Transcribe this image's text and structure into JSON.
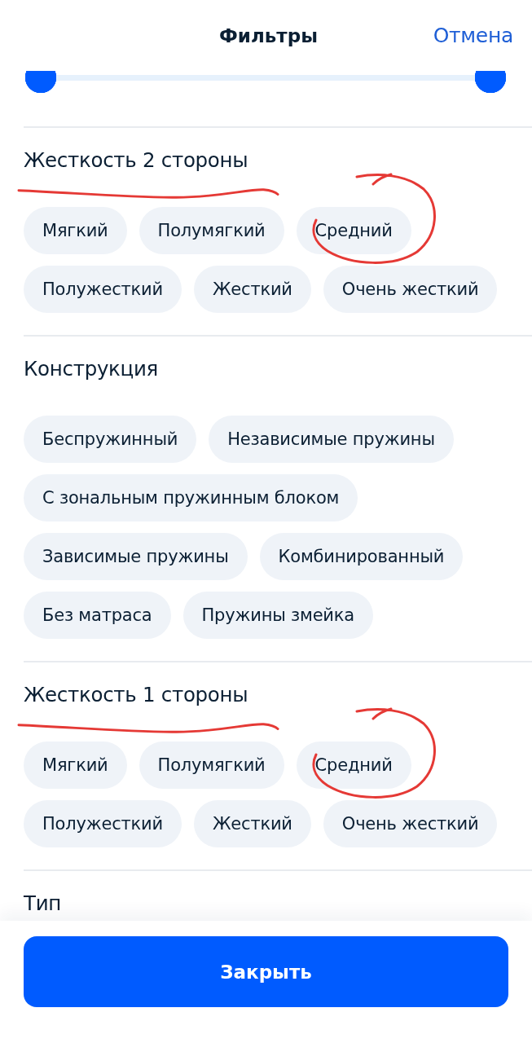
{
  "header": {
    "title": "Фильтры",
    "cancel": "Отмена"
  },
  "range_slider": {
    "thumbs": [
      {
        "level": 0
      },
      {
        "level": 1
      }
    ]
  },
  "sections": [
    {
      "title": "Жесткость 2 стороны",
      "underlined": true,
      "options": [
        {
          "label": "Мягкий",
          "selected": false,
          "circled": false
        },
        {
          "label": "Полумягкий",
          "selected": false,
          "circled": false
        },
        {
          "label": "Средний",
          "selected": false,
          "circled": true
        },
        {
          "label": "Полужесткий",
          "selected": false,
          "circled": false
        },
        {
          "label": "Жесткий",
          "selected": false,
          "circled": false
        },
        {
          "label": "Очень жесткий",
          "selected": false,
          "circled": false
        }
      ]
    },
    {
      "title": "Конструкция",
      "underlined": false,
      "options": [
        {
          "label": "Беспружинный",
          "selected": false,
          "circled": false
        },
        {
          "label": "Независимые пружины",
          "selected": false,
          "circled": false
        },
        {
          "label": "С зональным пружинным блоком",
          "selected": false,
          "circled": false
        },
        {
          "label": "Зависимые пружины",
          "selected": false,
          "circled": false
        },
        {
          "label": "Комбинированный",
          "selected": false,
          "circled": false
        },
        {
          "label": "Без матраса",
          "selected": false,
          "circled": false
        },
        {
          "label": "Пружины змейка",
          "selected": false,
          "circled": false
        }
      ]
    },
    {
      "title": "Жесткость 1 стороны",
      "underlined": true,
      "options": [
        {
          "label": "Мягкий",
          "selected": false,
          "circled": false
        },
        {
          "label": "Полумягкий",
          "selected": false,
          "circled": false
        },
        {
          "label": "Средний",
          "selected": false,
          "circled": true
        },
        {
          "label": "Полужесткий",
          "selected": false,
          "circled": false
        },
        {
          "label": "Жесткий",
          "selected": false,
          "circled": false
        },
        {
          "label": "Очень жесткий",
          "selected": false,
          "circled": false
        }
      ]
    },
    {
      "title": "Тип",
      "underlined": false
    }
  ],
  "footer": {
    "button": "Закрыть"
  }
}
